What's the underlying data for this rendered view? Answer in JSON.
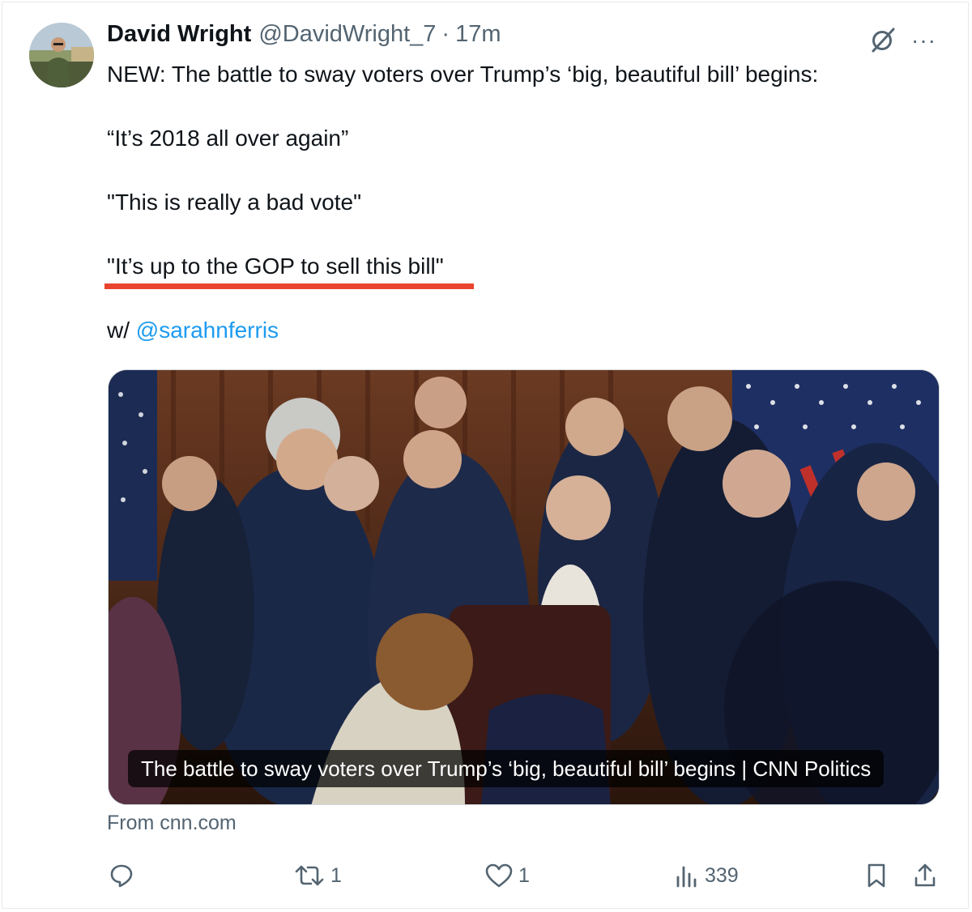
{
  "tweet": {
    "author_name": "David Wright",
    "handle": "@DavidWright_7",
    "separator": "·",
    "time": "17m",
    "more_label": "···",
    "paragraphs": [
      "NEW: The battle to sway voters over Trump’s ‘big, beautiful bill’ begins:",
      "“It’s 2018 all over again”",
      "\"This is really a bad vote\"",
      "\"It’s up to the GOP to sell this bill\""
    ],
    "with_prefix": "w/",
    "mention": "@sarahnferris"
  },
  "card": {
    "caption": "The battle to sway voters over Trump’s ‘big, beautiful bill’ begins | CNN Politics",
    "source": "From cnn.com"
  },
  "actions": {
    "reply_count": "",
    "repost_count": "1",
    "like_count": "1",
    "views_count": "339"
  },
  "icons": {
    "avatar": "avatar",
    "grok": "grok-icon",
    "more": "more-icon",
    "reply": "reply-icon",
    "repost": "repost-icon",
    "like": "heart-icon",
    "views": "views-icon",
    "bookmark": "bookmark-icon",
    "share": "share-icon"
  },
  "colors": {
    "text": "#0f1419",
    "secondary": "#536471",
    "link": "#1d9bf0",
    "highlight_underline": "#e8442f"
  }
}
